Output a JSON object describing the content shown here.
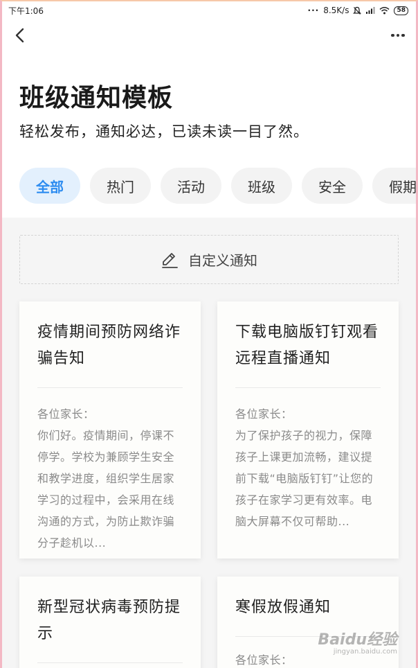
{
  "status_bar": {
    "time": "下午1:06",
    "network_speed": "8.5K/s",
    "battery": "58"
  },
  "nav": {
    "back_icon": "chevron-left-icon",
    "more_icon": "more-dots-icon"
  },
  "header": {
    "title": "班级通知模板",
    "subtitle": "轻松发布，通知必达，已读未读一目了然。"
  },
  "tabs": [
    {
      "label": "全部",
      "active": true
    },
    {
      "label": "热门",
      "active": false
    },
    {
      "label": "活动",
      "active": false
    },
    {
      "label": "班级",
      "active": false
    },
    {
      "label": "安全",
      "active": false
    },
    {
      "label": "假期",
      "active": false
    }
  ],
  "custom_notice": {
    "label": "自定义通知",
    "icon": "pencil-icon"
  },
  "cards": [
    {
      "title": "疫情期间预防网络诈骗告知",
      "greeting": "各位家长：",
      "body": "你们好。疫情期间，停课不停学。学校为兼顾学生安全和教学进度，组织学生居家学习的过程中，会采用在线沟通的方式，为防止欺诈骗分子趁机以..."
    },
    {
      "title": "下载电脑版钉钉观看远程直播通知",
      "greeting": "各位家长：",
      "body": "为了保护孩子的视力，保障孩子上课更加流畅，建议提前下载“电脑版钉钉”让您的孩子在家学习更有效率。电脑大屏幕不仅可帮助..."
    },
    {
      "title": "新型冠状病毒预防提示",
      "greeting": "",
      "body": ""
    },
    {
      "title": "寒假放假通知",
      "greeting": "各位家长：",
      "body": ""
    }
  ],
  "watermark": {
    "brand": "Baidu经验",
    "url": "jingyan.baidu.com"
  }
}
